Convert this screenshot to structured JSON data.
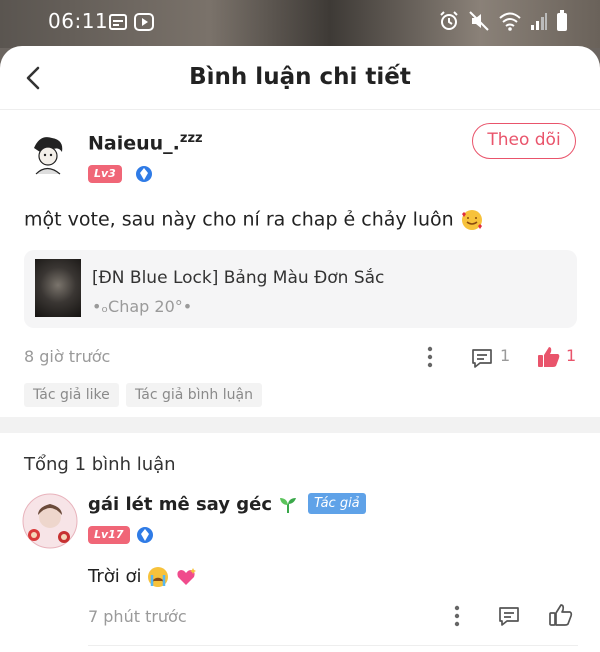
{
  "status_bar": {
    "time": "06:11"
  },
  "header": {
    "title": "Bình luận chi tiết"
  },
  "post": {
    "username": "Naieuu_.",
    "username_suffix": "zzz",
    "level": "Lv3",
    "follow_label": "Theo dõi",
    "text": "một vote, sau này cho ní ra chap ẻ chảy luôn",
    "story": {
      "title": "[ĐN Blue Lock] Bảng Màu Đơn Sắc",
      "chapter": "•ₒChap 20°•"
    },
    "time": "8 giờ trước",
    "comment_count": "1",
    "like_count": "1",
    "tags": [
      "Tác giả like",
      "Tác giả bình luận"
    ]
  },
  "comments_section": {
    "total_label": "Tổng 1 bình luận"
  },
  "reply": {
    "username": "gái lét mê say géc",
    "author_badge": "Tác giả",
    "level": "Lv17",
    "text": "Trời ơi",
    "time": "7 phút trước"
  },
  "colors": {
    "accent": "#e9546b",
    "author_badge": "#5fa2e8",
    "level_badge": "#f06677"
  }
}
